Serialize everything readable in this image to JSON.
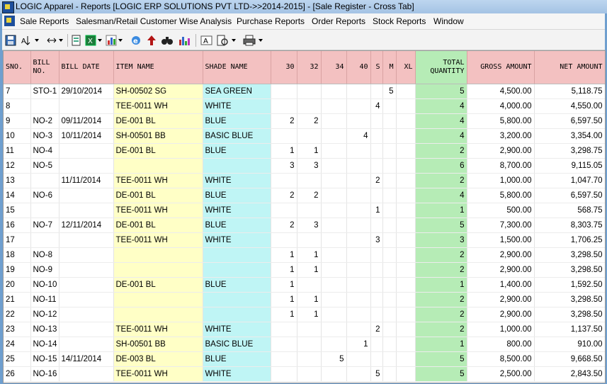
{
  "window": {
    "title": "LOGIC Apparel - Reports  [LOGIC ERP SOLUTIONS PVT LTD->>2014-2015] - [Sale Register - Cross Tab]"
  },
  "menu": [
    "Sale Reports",
    "Salesman/Retail Customer Wise Analysis",
    "Purchase Reports",
    "Order Reports",
    "Stock Reports",
    "Window"
  ],
  "toolbar": {
    "icons": [
      "save-icon",
      "sort-icon",
      "column-width-icon",
      "print-preview-icon",
      "excel-icon",
      "chart-icon",
      "browser-icon",
      "up-arrow-icon",
      "find-icon",
      "bar-chart-icon",
      "font-icon",
      "page-setup-icon",
      "printer-icon"
    ]
  },
  "grid": {
    "columns": [
      "SNO.",
      "BILL NO.",
      "BILL DATE",
      "ITEM NAME",
      "SHADE NAME",
      "30",
      "32",
      "34",
      "40",
      "S",
      "M",
      "XL",
      "TOTAL QUANTITY",
      "GROSS AMOUNT",
      "NET AMOUNT"
    ],
    "rows": [
      {
        "sno": "7",
        "bill": "STO-1",
        "date": "29/10/2014",
        "item": "SH-00502 SG",
        "shade": "SEA GREEN",
        "s30": "",
        "s32": "",
        "s34": "",
        "s40": "",
        "s": "",
        "m": "5",
        "xl": "",
        "total": "5",
        "gross": "4,500.00",
        "net": "5,118.75"
      },
      {
        "sno": "8",
        "bill": "",
        "date": "",
        "item": "TEE-0011 WH",
        "shade": "WHITE",
        "s30": "",
        "s32": "",
        "s34": "",
        "s40": "",
        "s": "4",
        "m": "",
        "xl": "",
        "total": "4",
        "gross": "4,000.00",
        "net": "4,550.00"
      },
      {
        "sno": "9",
        "bill": "NO-2",
        "date": "09/11/2014",
        "item": "DE-001 BL",
        "shade": "BLUE",
        "s30": "2",
        "s32": "2",
        "s34": "",
        "s40": "",
        "s": "",
        "m": "",
        "xl": "",
        "total": "4",
        "gross": "5,800.00",
        "net": "6,597.50"
      },
      {
        "sno": "10",
        "bill": "NO-3",
        "date": "10/11/2014",
        "item": "SH-00501 BB",
        "shade": "BASIC BLUE",
        "s30": "",
        "s32": "",
        "s34": "",
        "s40": "4",
        "s": "",
        "m": "",
        "xl": "",
        "total": "4",
        "gross": "3,200.00",
        "net": "3,354.00"
      },
      {
        "sno": "11",
        "bill": "NO-4",
        "date": "",
        "item": "DE-001 BL",
        "shade": "BLUE",
        "s30": "1",
        "s32": "1",
        "s34": "",
        "s40": "",
        "s": "",
        "m": "",
        "xl": "",
        "total": "2",
        "gross": "2,900.00",
        "net": "3,298.75"
      },
      {
        "sno": "12",
        "bill": "NO-5",
        "date": "",
        "item": "",
        "shade": "",
        "s30": "3",
        "s32": "3",
        "s34": "",
        "s40": "",
        "s": "",
        "m": "",
        "xl": "",
        "total": "6",
        "gross": "8,700.00",
        "net": "9,115.05"
      },
      {
        "sno": "13",
        "bill": "",
        "date": "11/11/2014",
        "item": "TEE-0011 WH",
        "shade": "WHITE",
        "s30": "",
        "s32": "",
        "s34": "",
        "s40": "",
        "s": "2",
        "m": "",
        "xl": "",
        "total": "2",
        "gross": "1,000.00",
        "net": "1,047.70"
      },
      {
        "sno": "14",
        "bill": "NO-6",
        "date": "",
        "item": "DE-001 BL",
        "shade": "BLUE",
        "s30": "2",
        "s32": "2",
        "s34": "",
        "s40": "",
        "s": "",
        "m": "",
        "xl": "",
        "total": "4",
        "gross": "5,800.00",
        "net": "6,597.50"
      },
      {
        "sno": "15",
        "bill": "",
        "date": "",
        "item": "TEE-0011 WH",
        "shade": "WHITE",
        "s30": "",
        "s32": "",
        "s34": "",
        "s40": "",
        "s": "1",
        "m": "",
        "xl": "",
        "total": "1",
        "gross": "500.00",
        "net": "568.75"
      },
      {
        "sno": "16",
        "bill": "NO-7",
        "date": "12/11/2014",
        "item": "DE-001 BL",
        "shade": "BLUE",
        "s30": "2",
        "s32": "3",
        "s34": "",
        "s40": "",
        "s": "",
        "m": "",
        "xl": "",
        "total": "5",
        "gross": "7,300.00",
        "net": "8,303.75"
      },
      {
        "sno": "17",
        "bill": "",
        "date": "",
        "item": "TEE-0011 WH",
        "shade": "WHITE",
        "s30": "",
        "s32": "",
        "s34": "",
        "s40": "",
        "s": "3",
        "m": "",
        "xl": "",
        "total": "3",
        "gross": "1,500.00",
        "net": "1,706.25"
      },
      {
        "sno": "18",
        "bill": "NO-8",
        "date": "",
        "item": "",
        "shade": "",
        "s30": "1",
        "s32": "1",
        "s34": "",
        "s40": "",
        "s": "",
        "m": "",
        "xl": "",
        "total": "2",
        "gross": "2,900.00",
        "net": "3,298.50"
      },
      {
        "sno": "19",
        "bill": "NO-9",
        "date": "",
        "item": "",
        "shade": "",
        "s30": "1",
        "s32": "1",
        "s34": "",
        "s40": "",
        "s": "",
        "m": "",
        "xl": "",
        "total": "2",
        "gross": "2,900.00",
        "net": "3,298.50"
      },
      {
        "sno": "20",
        "bill": "NO-10",
        "date": "",
        "item": "DE-001 BL",
        "shade": "BLUE",
        "s30": "1",
        "s32": "",
        "s34": "",
        "s40": "",
        "s": "",
        "m": "",
        "xl": "",
        "total": "1",
        "gross": "1,400.00",
        "net": "1,592.50"
      },
      {
        "sno": "21",
        "bill": "NO-11",
        "date": "",
        "item": "",
        "shade": "",
        "s30": "1",
        "s32": "1",
        "s34": "",
        "s40": "",
        "s": "",
        "m": "",
        "xl": "",
        "total": "2",
        "gross": "2,900.00",
        "net": "3,298.50"
      },
      {
        "sno": "22",
        "bill": "NO-12",
        "date": "",
        "item": "",
        "shade": "",
        "s30": "1",
        "s32": "1",
        "s34": "",
        "s40": "",
        "s": "",
        "m": "",
        "xl": "",
        "total": "2",
        "gross": "2,900.00",
        "net": "3,298.50"
      },
      {
        "sno": "23",
        "bill": "NO-13",
        "date": "",
        "item": "TEE-0011 WH",
        "shade": "WHITE",
        "s30": "",
        "s32": "",
        "s34": "",
        "s40": "",
        "s": "2",
        "m": "",
        "xl": "",
        "total": "2",
        "gross": "1,000.00",
        "net": "1,137.50"
      },
      {
        "sno": "24",
        "bill": "NO-14",
        "date": "",
        "item": "SH-00501 BB",
        "shade": "BASIC BLUE",
        "s30": "",
        "s32": "",
        "s34": "",
        "s40": "1",
        "s": "",
        "m": "",
        "xl": "",
        "total": "1",
        "gross": "800.00",
        "net": "910.00"
      },
      {
        "sno": "25",
        "bill": "NO-15",
        "date": "14/11/2014",
        "item": "DE-003 BL",
        "shade": "BLUE",
        "s30": "",
        "s32": "",
        "s34": "5",
        "s40": "",
        "s": "",
        "m": "",
        "xl": "",
        "total": "5",
        "gross": "8,500.00",
        "net": "9,668.50"
      },
      {
        "sno": "26",
        "bill": "NO-16",
        "date": "",
        "item": "TEE-0011 WH",
        "shade": "WHITE",
        "s30": "",
        "s32": "",
        "s34": "",
        "s40": "",
        "s": "5",
        "m": "",
        "xl": "",
        "total": "5",
        "gross": "2,500.00",
        "net": "2,843.50"
      }
    ]
  },
  "colors": {
    "header": "#f3c1c1",
    "item": "#ffffc6",
    "shade": "#bff5f5",
    "total": "#b6ecb6"
  }
}
